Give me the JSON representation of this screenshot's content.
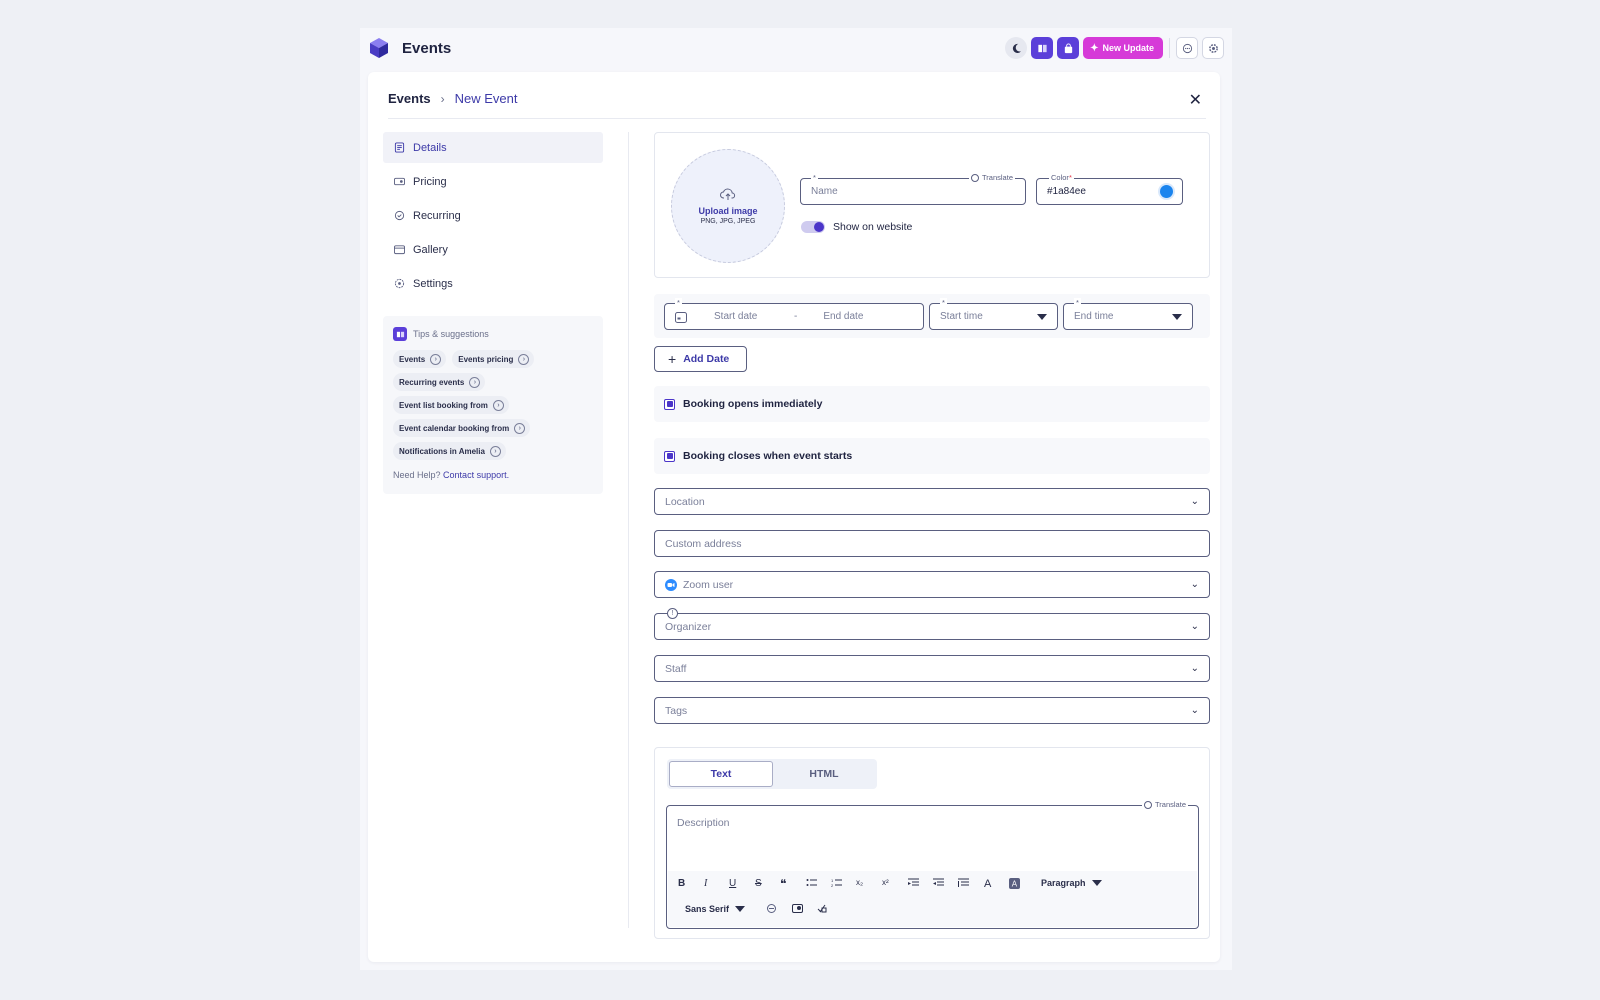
{
  "app": {
    "title": "Events",
    "new_update_label": "New Update"
  },
  "breadcrumb": {
    "root": "Events",
    "current": "New Event"
  },
  "sidebar": {
    "items": [
      {
        "label": "Details",
        "icon": "details-icon",
        "active": true
      },
      {
        "label": "Pricing",
        "icon": "pricing-icon",
        "active": false
      },
      {
        "label": "Recurring",
        "icon": "recurring-icon",
        "active": false
      },
      {
        "label": "Gallery",
        "icon": "gallery-icon",
        "active": false
      },
      {
        "label": "Settings",
        "icon": "settings-icon",
        "active": false
      }
    ]
  },
  "tips": {
    "title": "Tips & suggestions",
    "chips": [
      "Events",
      "Events pricing",
      "Recurring events",
      "Event list booking from",
      "Event calendar booking from",
      "Notifications in Amelia"
    ],
    "help_prefix": "Need Help?",
    "help_link": "Contact support."
  },
  "form": {
    "upload_label": "Upload image",
    "upload_formats": "PNG, JPG, JPEG",
    "name_placeholder": "Name",
    "translate_label": "Translate",
    "color_label": "Color",
    "color_value": "#1a84ee",
    "show_on_website_label": "Show on website",
    "start_date_placeholder": "Start date",
    "date_separator": "-",
    "end_date_placeholder": "End date",
    "start_time_placeholder": "Start time",
    "end_time_placeholder": "End time",
    "add_date_label": "Add Date",
    "booking_opens_label": "Booking opens immediately",
    "booking_closes_label": "Booking closes when event starts",
    "location_placeholder": "Location",
    "custom_address_placeholder": "Custom address",
    "zoom_user_placeholder": "Zoom user",
    "organizer_placeholder": "Organizer",
    "staff_placeholder": "Staff",
    "tags_placeholder": "Tags"
  },
  "editor": {
    "tabs": [
      "Text",
      "HTML"
    ],
    "active_tab": "Text",
    "translate_label": "Translate",
    "description_placeholder": "Description",
    "paragraph_label": "Paragraph",
    "font_label": "Sans Serif",
    "tool_bold": "B",
    "tool_italic": "I",
    "tool_underline": "U",
    "tool_strike": "S",
    "tool_quote": "❝",
    "tool_sub": "x₂",
    "tool_sup": "x²",
    "tool_font_color": "A"
  },
  "colors": {
    "accent": "#3d3aa8",
    "brand_purple": "#5b3fd9",
    "update_pink": "#d63ad8",
    "event_color": "#1a84ee"
  }
}
